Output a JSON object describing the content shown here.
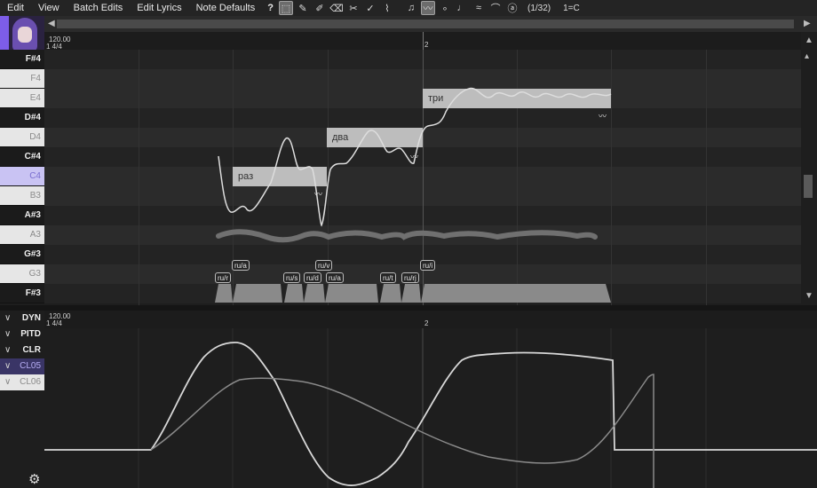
{
  "menu": {
    "edit": "Edit",
    "view": "View",
    "batch_edits": "Batch Edits",
    "edit_lyrics": "Edit Lyrics",
    "note_defaults": "Note Defaults",
    "help": "?"
  },
  "toolbar": {
    "snap": "(1/32)",
    "key": "1=C"
  },
  "ruler": {
    "tempo": "120.00",
    "signature": "1 4/4",
    "bar2": "2"
  },
  "keys": [
    "F#4",
    "F4",
    "E4",
    "D#4",
    "D4",
    "C#4",
    "C4",
    "B3",
    "A#3",
    "A3",
    "G#3",
    "G3",
    "F#3"
  ],
  "notes": [
    {
      "lyric": "раз"
    },
    {
      "lyric": "два"
    },
    {
      "lyric": "три"
    }
  ],
  "phonemes": [
    "ru/r",
    "ru/a",
    "ru/s",
    "ru/d",
    "ru/v",
    "ru/a",
    "ru/t",
    "ru/rj",
    "ru/i"
  ],
  "expressions": {
    "rows": [
      "DYN",
      "PITD",
      "CLR",
      "CL05",
      "CL06"
    ]
  },
  "exp_ruler": {
    "tempo": "120.00",
    "signature": "1 4/4",
    "bar2": "2"
  },
  "icons": {
    "settings": "gear-icon",
    "vibrato": "vibrato-icon"
  },
  "colors": {
    "accent": "#7d5de8",
    "note": "#bdbdbd",
    "curve": "#dddddd"
  }
}
